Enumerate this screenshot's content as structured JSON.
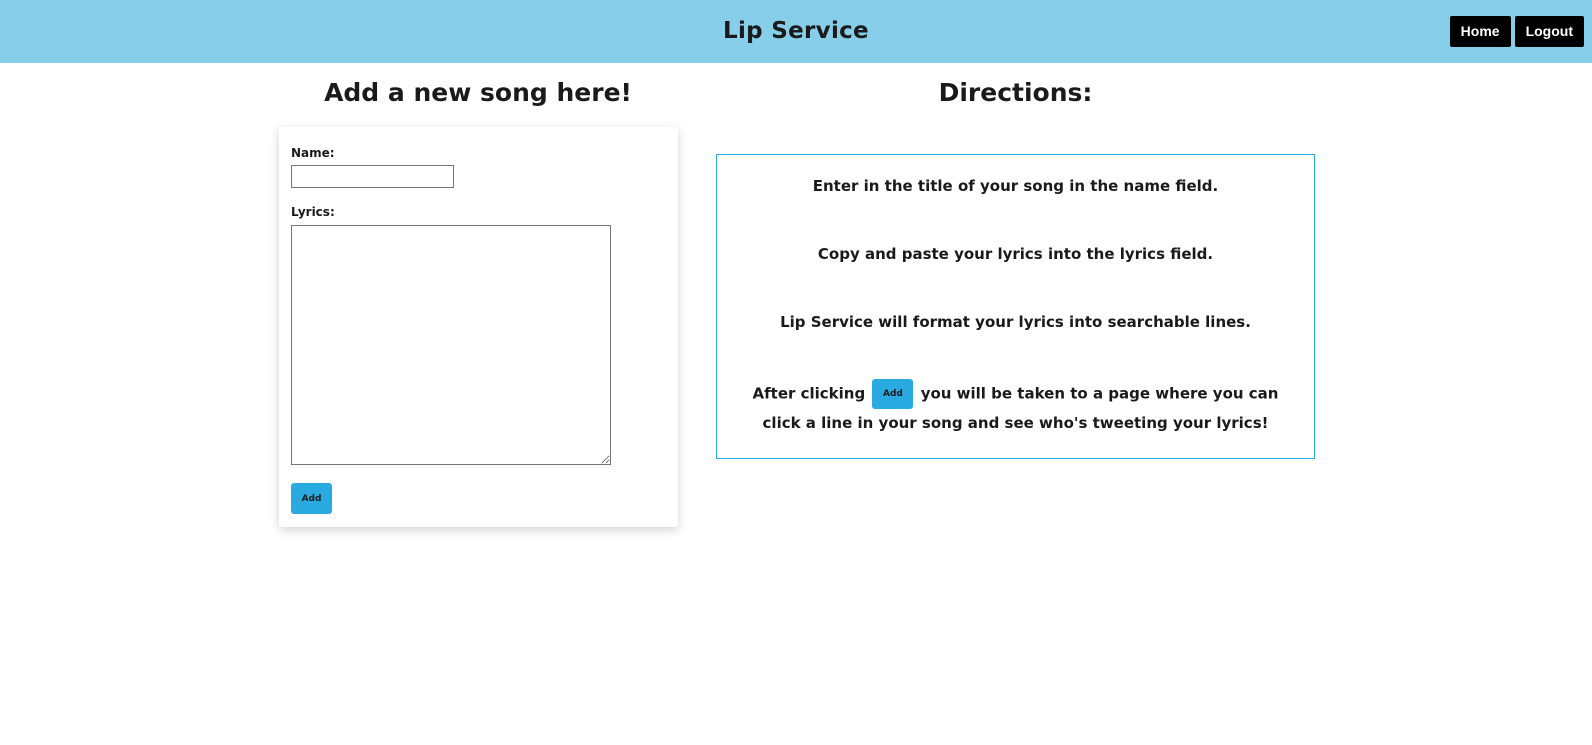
{
  "navbar": {
    "brand": "Lip Service",
    "home_label": "Home",
    "logout_label": "Logout",
    "background_color": "#87ceeb"
  },
  "form": {
    "heading": "Add a new song here!",
    "name_label": "Name:",
    "name_value": "",
    "lyrics_label": "Lyrics:",
    "lyrics_value": "",
    "add_label": "Add",
    "accent_color": "#29abe2"
  },
  "directions": {
    "heading": "Directions:",
    "line1": "Enter in the title of your song in the name field.",
    "line2": "Copy and paste your lyrics into the lyrics field.",
    "line3": "Lip Service will format your lyrics into searchable lines.",
    "line4_before": "After clicking",
    "line4_button": "Add",
    "line4_after": "you will be taken to a page where you can click a line in your song and see who's tweeting your lyrics!"
  }
}
